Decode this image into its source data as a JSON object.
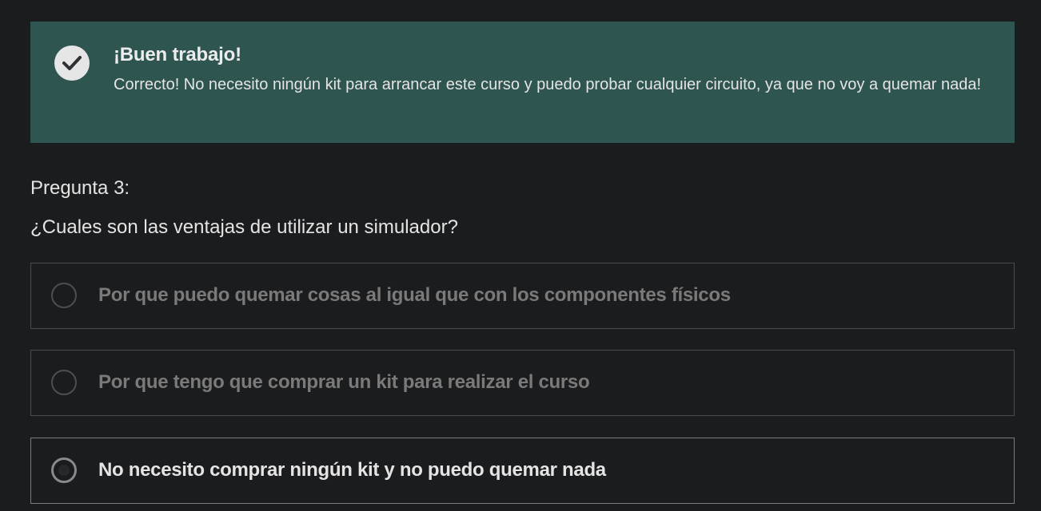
{
  "feedback": {
    "icon": "check-circle-icon",
    "title": "¡Buen trabajo!",
    "message": "Correcto! No necesito ningún kit para arrancar este curso y puedo probar cualquier circuito, ya que no voy a quemar nada!",
    "background_color": "#2e5550"
  },
  "question": {
    "label": "Pregunta 3:",
    "text": "¿Cuales son las ventajas de utilizar un simulador?",
    "options": [
      {
        "label": "Por que puedo quemar cosas al igual que con los componentes físicos",
        "selected": false
      },
      {
        "label": "Por que tengo que comprar un kit para realizar el curso",
        "selected": false
      },
      {
        "label": "No necesito comprar ningún kit y no puedo quemar nada",
        "selected": true
      }
    ]
  }
}
